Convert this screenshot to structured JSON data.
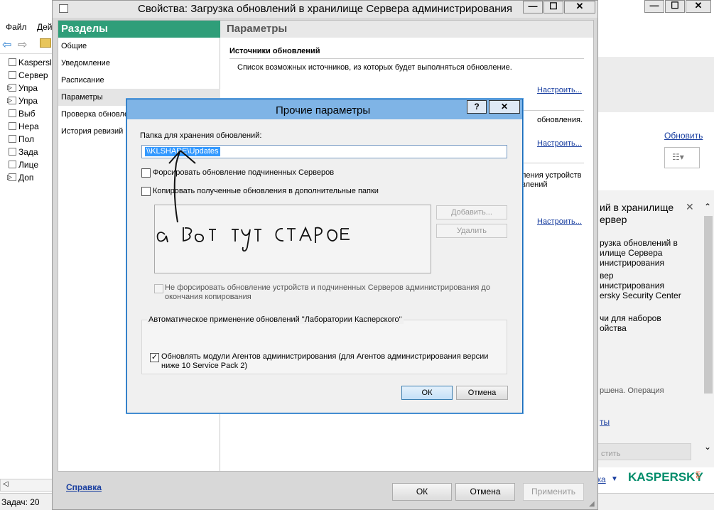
{
  "background_app": {
    "menu": [
      "Файл",
      "Дей"
    ],
    "tree": [
      {
        "label": "Kaspersky S",
        "icon": "kaspersky-icon",
        "expander": ""
      },
      {
        "label": "Сервер",
        "icon": "server-icon",
        "expander": ""
      },
      {
        "label": "Упра",
        "icon": "monitor-icon",
        "expander": "▷"
      },
      {
        "label": "Упра",
        "icon": "phone-icon",
        "expander": "▷"
      },
      {
        "label": "Выб",
        "icon": "selection-icon",
        "expander": ""
      },
      {
        "label": "Нера",
        "icon": "unassigned-icon",
        "expander": ""
      },
      {
        "label": "Пол",
        "icon": "policy-icon",
        "expander": ""
      },
      {
        "label": "Зада",
        "icon": "tasks-icon",
        "expander": ""
      },
      {
        "label": "Лице",
        "icon": "license-icon",
        "expander": ""
      },
      {
        "label": "Доп",
        "icon": "grid-icon",
        "expander": "▷"
      }
    ],
    "status": "Задач: 20",
    "refresh_link": "Обновить",
    "right_panel": {
      "title": "ий в хранилище\nервер",
      "lines": [
        "рузка обновлений в",
        "илище Сервера",
        "инистрирования",
        "вер",
        "инистрирования",
        "ersky Security Center",
        "чи для наборов",
        "ойства",
        "ршена. Операция"
      ],
      "link": "ты",
      "button": "стить"
    },
    "bottom_link": "жа",
    "brand": "KASPERSKY"
  },
  "properties_window": {
    "title": "Свойства: Загрузка обновлений в хранилище Сервера администрирования",
    "sections_header": "Разделы",
    "sections": [
      "Общие",
      "Уведомление",
      "Расписание",
      "Параметры",
      "Проверка обновле",
      "История ревизий"
    ],
    "selected_section": 3,
    "content_header": "Параметры",
    "group_title": "Источники обновлений",
    "group_desc": "Список возможных источников, из которых будет выполняться обновление.",
    "configure_link": "Настроить...",
    "fragment_1": "обновления.",
    "fragment_2": "ления устройств",
    "fragment_3": "влений",
    "help_link": "Справка",
    "ok": "ОК",
    "cancel": "Отмена",
    "apply": "Применить"
  },
  "dialog": {
    "title": "Прочие параметры",
    "help_btn": "?",
    "close_btn": "✕",
    "folder_label": "Папка для хранения обновлений:",
    "folder_value": "\\\\KLSHARE\\Updates",
    "cb_force": "Форсировать обновление подчиненных Серверов",
    "cb_copy": "Копировать полученные обновления в дополнительные папки",
    "add_btn": "Добавить...",
    "delete_btn": "Удалить",
    "handwriting": "а вот тут старое",
    "cb_noforce": "Не форсировать обновление устройств и подчиненных Серверов администрирования до окончания копирования",
    "auto_group": "Автоматическое применение обновлений \"Лаборатории Касперского\"",
    "cb_agents": "Обновлять модули Агентов администрирования (для Агентов администрирования версии ниже 10 Service Pack 2)",
    "ok": "ОК",
    "cancel": "Отмена"
  },
  "colors": {
    "accent_green": "#2f9e79",
    "dialog_border": "#1a6bb8",
    "selection": "#3399ff"
  }
}
